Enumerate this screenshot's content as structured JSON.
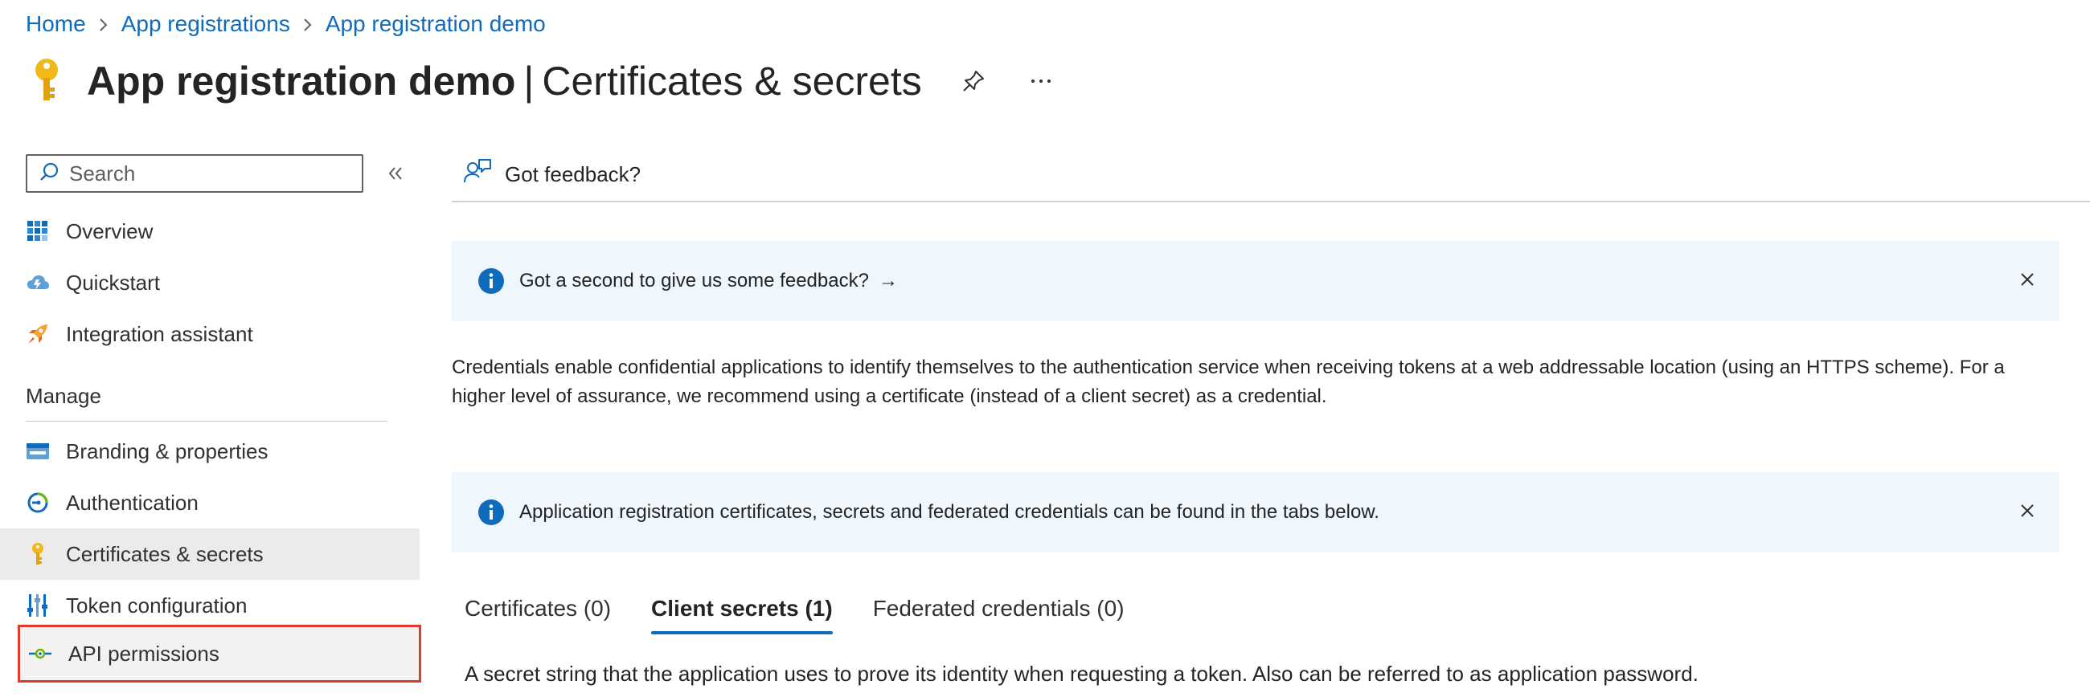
{
  "breadcrumb": {
    "items": [
      "Home",
      "App registrations",
      "App registration demo"
    ]
  },
  "header": {
    "title_main": "App registration demo",
    "title_separator": "|",
    "title_sub": "Certificates & secrets",
    "icon": "key-icon",
    "pin_icon": "pin-icon",
    "more_label": "···"
  },
  "sidebar": {
    "search_placeholder": "Search",
    "collapse_icon": "double-chevron-left-icon",
    "items": [
      {
        "label": "Overview",
        "icon": "grid-icon"
      },
      {
        "label": "Quickstart",
        "icon": "cloud-icon"
      },
      {
        "label": "Integration assistant",
        "icon": "rocket-icon"
      }
    ],
    "section_label": "Manage",
    "manage_items": [
      {
        "label": "Branding & properties",
        "icon": "branding-icon"
      },
      {
        "label": "Authentication",
        "icon": "authentication-icon"
      },
      {
        "label": "Certificates & secrets",
        "icon": "key-icon",
        "selected": true
      },
      {
        "label": "Token configuration",
        "icon": "sliders-icon"
      },
      {
        "label": "API permissions",
        "icon": "api-icon",
        "highlighted": true
      }
    ]
  },
  "main": {
    "feedback_label": "Got feedback?",
    "banner1": {
      "text": "Got a second to give us some feedback?",
      "arrow": "→"
    },
    "description": "Credentials enable confidential applications to identify themselves to the authentication service when receiving tokens at a web addressable location (using an HTTPS scheme). For a higher level of assurance, we recommend using a certificate (instead of a client secret) as a credential.",
    "banner2": {
      "text": "Application registration certificates, secrets and federated credentials can be found in the tabs below."
    },
    "tabs": [
      {
        "label": "Certificates (0)"
      },
      {
        "label": "Client secrets (1)",
        "active": true
      },
      {
        "label": "Federated credentials (0)"
      }
    ],
    "tab_description": "A secret string that the application uses to prove its identity when requesting a token. Also can be referred to as application password."
  },
  "colors": {
    "link": "#0f6cbd",
    "banner_bg": "#eff6fc",
    "info_icon": "#0f6cbd",
    "selected_bg": "#edebe9",
    "highlight_border": "#e03b2f",
    "key": "#f2b81a"
  }
}
